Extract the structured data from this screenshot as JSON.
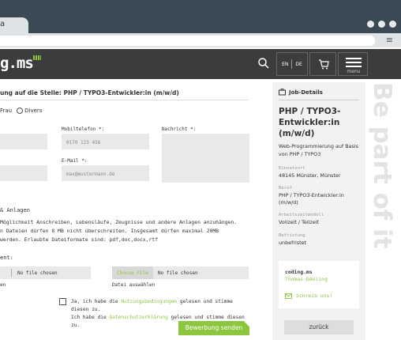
{
  "browser": {
    "tab_label": "a",
    "menu_icon": "hamburger-icon"
  },
  "header": {
    "logo_text": "g.ms",
    "lang": {
      "en": "EN",
      "de": "DE"
    },
    "menu_label": "menu"
  },
  "form": {
    "title": "ung auf die Stelle: PHP / TYPO3-Entwickler:in (m/w/d)",
    "salutation": {
      "frau": "Frau",
      "divers": "Divers"
    },
    "mobile_label": "Mobiltelefon *:",
    "mobile_placeholder": "0170 123 456",
    "message_label": "Nachricht *:",
    "email_label": "E-Mail *:",
    "email_placeholder": "max@mustermann.de",
    "attachments_heading": "& Anlagen",
    "attachments_text_1": "Möglichkeit Anschreiben, Lebensläufe, Zeugnisse und andere Anlagen anzuhängen.",
    "attachments_text_2": "n Dateien dürfen 8 MB nicht überschreiten. Insgesamt dürfen maximal 20MB",
    "attachments_text_3": "werden. Erlaubte Dateiformate sind: pdf,doc,docx,rtf",
    "upload_label": "ent:",
    "file1_status": "No file chosen",
    "file1_hint": "en",
    "file2_button": "Choose File",
    "file2_status": "No file chosen",
    "file2_hint": "Datei auswählen",
    "consent": {
      "part1": "Ja, ich habe die ",
      "link1": "Nutzungsbedingungen",
      "part2": " gelesen und stimme diesen zu.",
      "part3": "Ich habe die ",
      "link2": "Datenschutzerklärung",
      "part4": " gelesen und stimme diesen zu."
    },
    "submit": "Bewerbung senden"
  },
  "job": {
    "heading": "Job-Details",
    "title": "PHP / TYPO3-Entwickler:in (m/w/d)",
    "subtitle": "Web-Programmierung auf Basis von PHP / TYPO3",
    "location_label": "Einsatzort",
    "location": "48145 Münster, Münster",
    "job_label": "Beruf",
    "job": "PHP / TYPO3-Entwickler:in (m/w/d)",
    "model_label": "Arbeitszeitmodell",
    "model": "Vollzeit / Teilzeit",
    "term_label": "Befristung",
    "term": "unbefristet",
    "company": "coding.ms",
    "contact_person": "Thomas Deuling",
    "write_us": "Schreib uns!",
    "back": "zurück"
  },
  "side_text": "Be part of it",
  "colors": {
    "accent": "#8cc63f",
    "header": "#3c3c3c",
    "chrome": "#3a4a55"
  }
}
